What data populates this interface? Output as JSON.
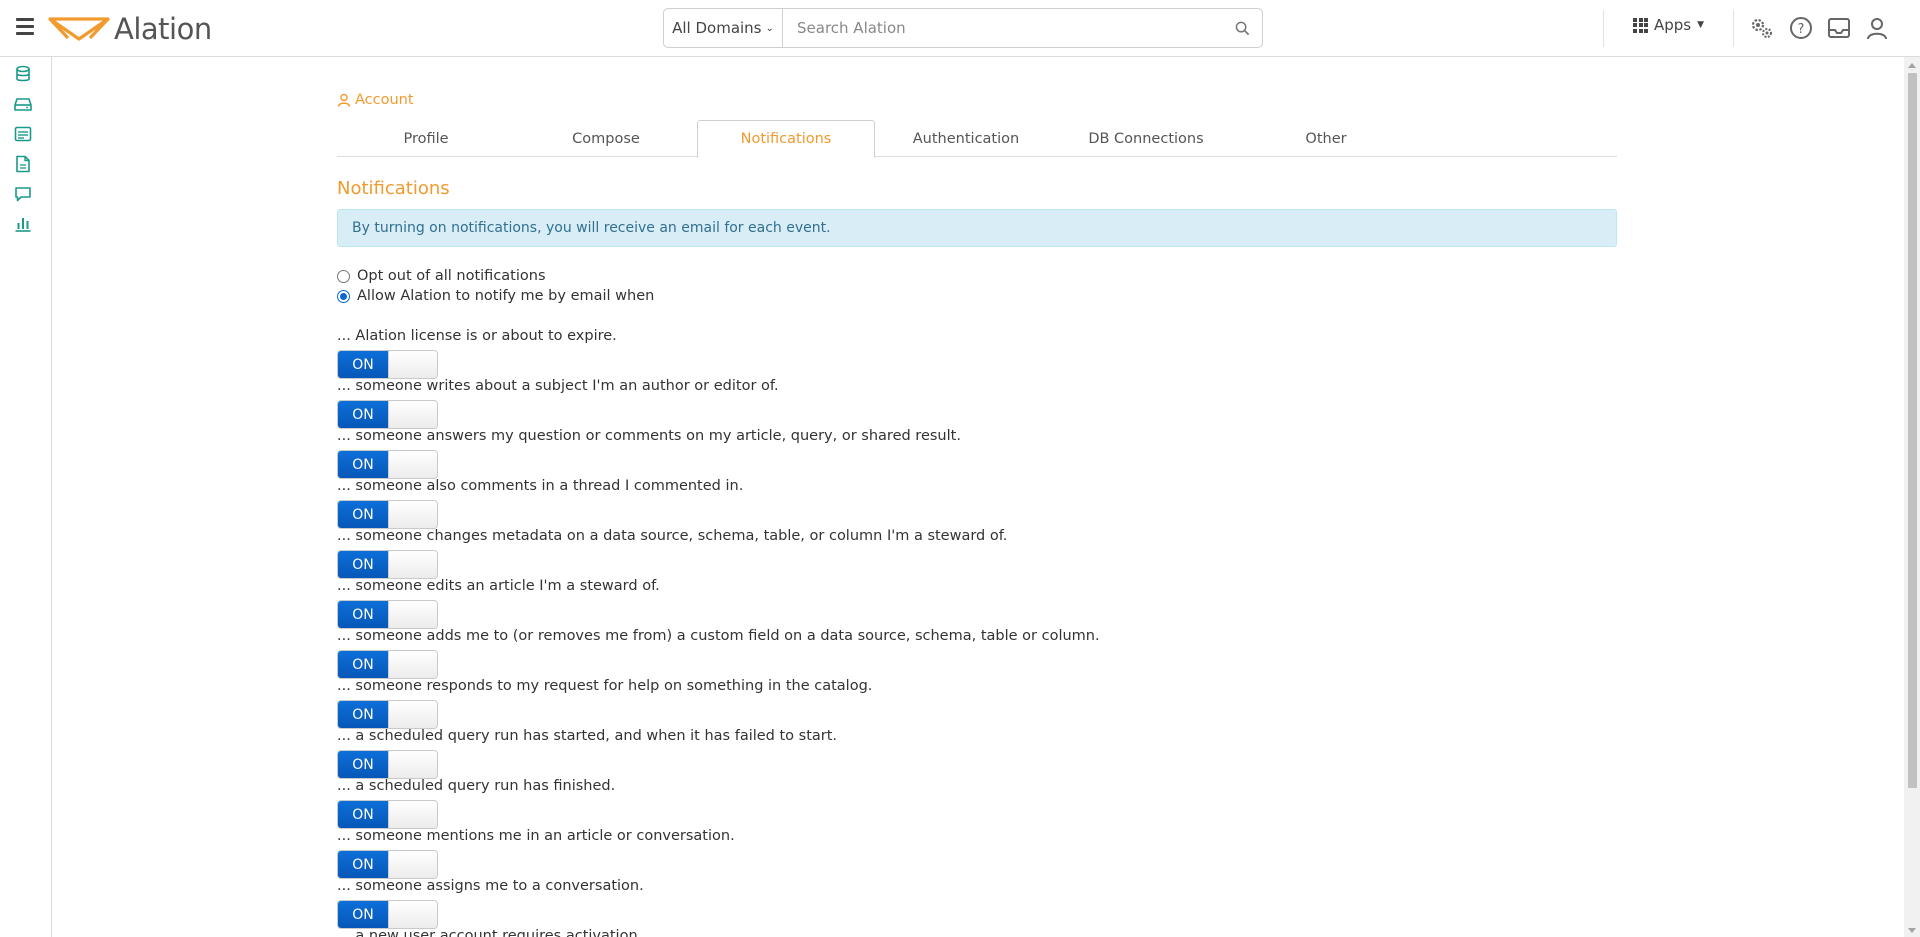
{
  "header": {
    "logo_text": "Alation",
    "domain_select": "All Domains",
    "search_placeholder": "Search Alation",
    "apps_label": "Apps",
    "brand_color": "#f29a2e",
    "icons": [
      "menu-icon",
      "search-icon",
      "apps-grid-icon",
      "settings-gears-icon",
      "help-icon",
      "inbox-icon",
      "user-icon"
    ]
  },
  "leftrail": {
    "icons": [
      "database-icon",
      "storage-icon",
      "catalog-table-icon",
      "document-icon",
      "conversation-icon",
      "bar-chart-icon"
    ],
    "icon_color": "#1a9a8a"
  },
  "breadcrumb": {
    "label": "Account"
  },
  "tabs": [
    {
      "label": "Profile",
      "active": false
    },
    {
      "label": "Compose",
      "active": false
    },
    {
      "label": "Notifications",
      "active": true
    },
    {
      "label": "Authentication",
      "active": false
    },
    {
      "label": "DB Connections",
      "active": false
    },
    {
      "label": "Other",
      "active": false
    }
  ],
  "section_title": "Notifications",
  "alert_text": "By turning on notifications, you will receive an email for each event.",
  "radios": [
    {
      "label": "Opt out of all notifications",
      "checked": false
    },
    {
      "label": "Allow Alation to notify me by email when",
      "checked": true
    }
  ],
  "toggle_on_label": "ON",
  "notifications": [
    {
      "label": "... Alation license is or about to expire.",
      "state": "ON"
    },
    {
      "label": "... someone writes about a subject I'm an author or editor of.",
      "state": "ON"
    },
    {
      "label": "... someone answers my question or comments on my article, query, or shared result.",
      "state": "ON"
    },
    {
      "label": "... someone also comments in a thread I commented in.",
      "state": "ON"
    },
    {
      "label": "... someone changes metadata on a data source, schema, table, or column I'm a steward of.",
      "state": "ON"
    },
    {
      "label": "... someone edits an article I'm a steward of.",
      "state": "ON"
    },
    {
      "label": "... someone adds me to (or removes me from) a custom field on a data source, schema, table or column.",
      "state": "ON"
    },
    {
      "label": "... someone responds to my request for help on something in the catalog.",
      "state": "ON"
    },
    {
      "label": "... a scheduled query run has started, and when it has failed to start.",
      "state": "ON"
    },
    {
      "label": "... a scheduled query run has finished.",
      "state": "ON"
    },
    {
      "label": "... someone mentions me in an article or conversation.",
      "state": "ON"
    },
    {
      "label": "... someone assigns me to a conversation.",
      "state": "ON"
    },
    {
      "label": "... a new user account requires activation.",
      "state": "ON"
    }
  ]
}
